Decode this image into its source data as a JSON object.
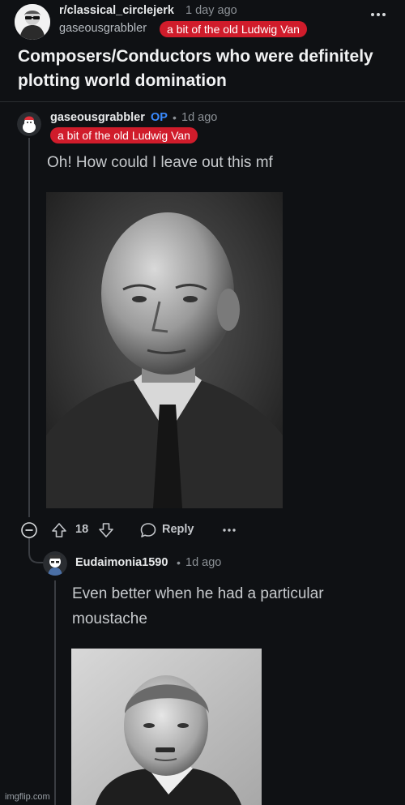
{
  "post": {
    "subreddit": "r/classical_circlejerk",
    "age": "1 day ago",
    "username": "gaseousgrabbler",
    "flair": "a bit of the old Ludwig Van",
    "title": "Composers/Conductors who were definitely plotting world domination",
    "more_icon": "more-horizontal-icon"
  },
  "comments": [
    {
      "username": "gaseousgrabbler",
      "op_badge": "OP",
      "separator": "•",
      "age": "1d ago",
      "flair": "a bit of the old Ludwig Van",
      "body": "Oh! How could I leave out this mf",
      "image": "Black-and-white portrait photo of a bald elderly man in suit and tie",
      "actions": {
        "collapse_icon": "collapse-minus-icon",
        "upvote_icon": "upvote-arrow-icon",
        "score": "18",
        "downvote_icon": "downvote-arrow-icon",
        "reply_icon": "reply-bubble-icon",
        "reply_label": "Reply",
        "more_icon": "more-horizontal-icon"
      }
    },
    {
      "username": "Eudaimonia1590",
      "separator": "•",
      "age": "1d ago",
      "body": "Even better when he had a particular moustache",
      "image": "Black-and-white portrait photo of a man with short hair and small moustache"
    }
  ],
  "watermark": "imgflip.com",
  "colors": {
    "background": "#0f1114",
    "flair": "#d01c2b",
    "op": "#3a8bff",
    "thread_line": "#3a3d42"
  }
}
